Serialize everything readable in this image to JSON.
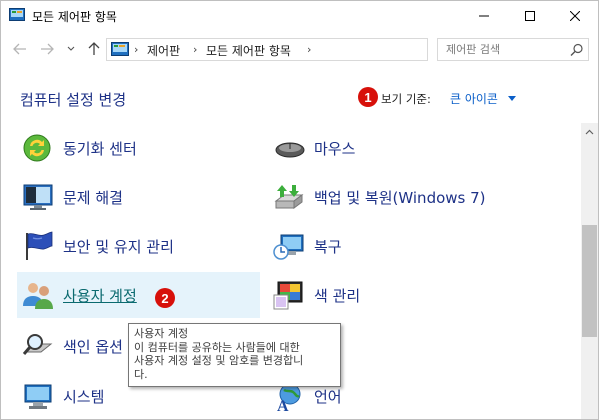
{
  "window": {
    "title": "모든 제어판 항목",
    "minimize_icon": "minimize-icon",
    "maximize_icon": "maximize-icon",
    "close_icon": "close-icon"
  },
  "navigation": {
    "breadcrumbs": [
      "제어판",
      "모든 제어판 항목"
    ],
    "search_placeholder": "제어판 검색"
  },
  "header": {
    "title": "컴퓨터 설정 변경",
    "view_by_label": "보기 기준:",
    "view_by_value": "큰 아이콘"
  },
  "markers": [
    "1",
    "2"
  ],
  "items_left": [
    {
      "label": "동기화 센터",
      "icon": "sync-center-icon"
    },
    {
      "label": "문제 해결",
      "icon": "troubleshooting-icon"
    },
    {
      "label": "보안 및 유지 관리",
      "icon": "security-flag-icon"
    },
    {
      "label": "사용자 계정",
      "icon": "user-accounts-icon"
    },
    {
      "label": "색인 옵션",
      "icon": "indexing-options-icon"
    },
    {
      "label": "시스템",
      "icon": "system-icon"
    }
  ],
  "items_right": [
    {
      "label": "마우스",
      "icon": "mouse-icon"
    },
    {
      "label": "백업 및 복원(Windows 7)",
      "icon": "backup-restore-icon"
    },
    {
      "label": "복구",
      "icon": "recovery-icon"
    },
    {
      "label": "색 관리",
      "icon": "color-management-icon"
    },
    {
      "label": "",
      "icon": "hidden-item-icon"
    },
    {
      "label": "언어",
      "icon": "language-icon"
    }
  ],
  "tooltip": {
    "title": "사용자 계정",
    "line1": "이 컴퓨터를 공유하는 사람들에 대한",
    "line2": "사용자 계정 설정 및 암호를 변경합니",
    "line3": "다."
  },
  "colors": {
    "link": "#1e3287",
    "accent": "#0b5fc9",
    "marker": "#d7100a",
    "hover_bg": "#e5f3fb"
  }
}
